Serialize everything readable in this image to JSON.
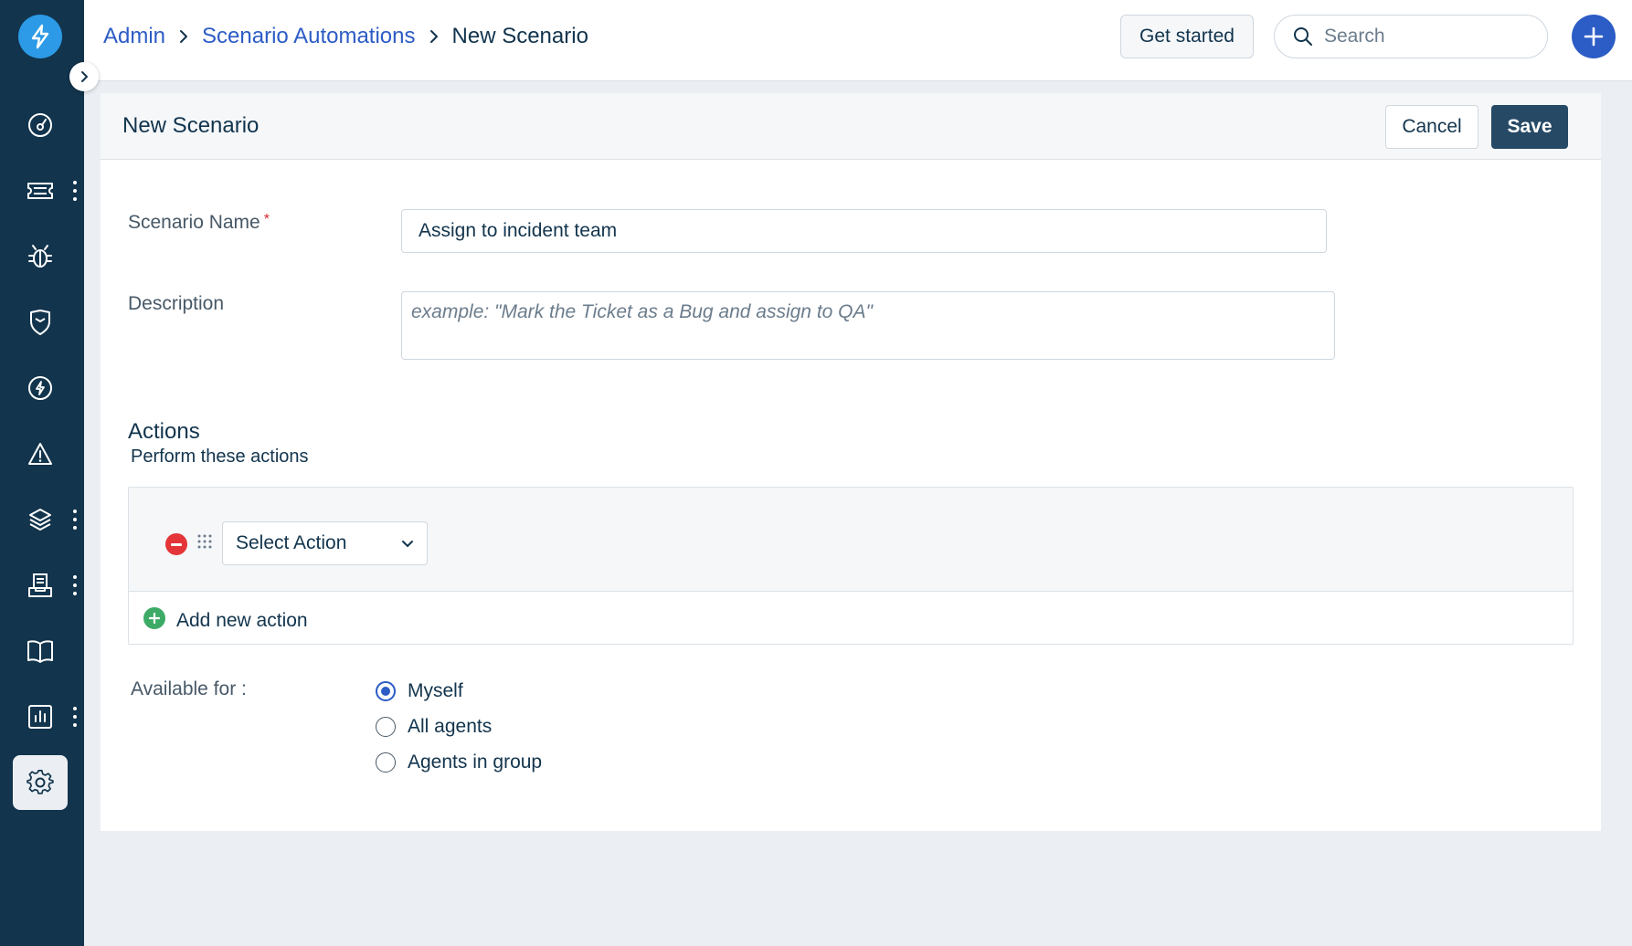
{
  "sidebar": {
    "logo_icon": "lightning-bolt-icon",
    "collapse_icon": "chevron-right-icon",
    "items": [
      {
        "icon": "dashboard-icon",
        "has_more": false
      },
      {
        "icon": "ticket-icon",
        "has_more": true
      },
      {
        "icon": "bug-icon",
        "has_more": false
      },
      {
        "icon": "shield-icon",
        "has_more": false
      },
      {
        "icon": "bolt-circle-icon",
        "has_more": false
      },
      {
        "icon": "alert-triangle-icon",
        "has_more": false
      },
      {
        "icon": "layers-icon",
        "has_more": true
      },
      {
        "icon": "inbox-document-icon",
        "has_more": true
      },
      {
        "icon": "book-icon",
        "has_more": false
      },
      {
        "icon": "bar-chart-icon",
        "has_more": true
      },
      {
        "icon": "gear-icon",
        "has_more": false,
        "active": true
      }
    ]
  },
  "header": {
    "breadcrumb": {
      "admin": "Admin",
      "scenario_automations": "Scenario Automations",
      "current": "New Scenario"
    },
    "get_started_label": "Get started",
    "search_placeholder": "Search"
  },
  "card": {
    "title": "New Scenario",
    "cancel_label": "Cancel",
    "save_label": "Save",
    "scenario_name_label": "Scenario Name",
    "required_mark": "*",
    "scenario_name_value": "Assign to incident team",
    "description_label": "Description",
    "description_placeholder": "example: \"Mark the Ticket as a Bug and assign to QA\"",
    "actions_title": "Actions",
    "actions_subtitle": "Perform these actions",
    "select_action_label": "Select Action",
    "add_new_action_label": "Add new action",
    "available_for_label": "Available for :",
    "availability_options": [
      {
        "label": "Myself",
        "checked": true
      },
      {
        "label": "All agents",
        "checked": false
      },
      {
        "label": "Agents in group",
        "checked": false
      }
    ]
  },
  "colors": {
    "sidebar_bg": "#12344d",
    "link_blue": "#2c5cc5",
    "save_bg": "#264966",
    "logo_bg": "#2c9ae6",
    "remove_red": "#e43538",
    "add_green": "#3dab66"
  }
}
